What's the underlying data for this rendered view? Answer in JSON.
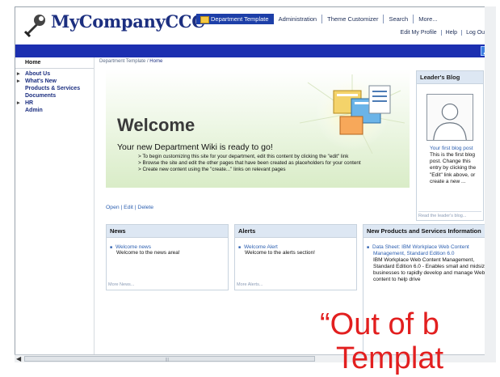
{
  "header": {
    "brand": "MyCompanyCCC",
    "tabs": [
      {
        "label": "Department Template",
        "active": true
      },
      {
        "label": "Administration"
      },
      {
        "label": "Theme Customizer"
      },
      {
        "label": "Search"
      },
      {
        "label": "More..."
      }
    ],
    "subnav": [
      "Edit My Profile",
      "Help",
      "Log Out"
    ]
  },
  "colors": {
    "brand": "#1c2f80",
    "bar": "#1c2fb0",
    "overlay": "#e21f1f"
  },
  "leftnav": [
    {
      "label": "Home",
      "arrow": false,
      "home": true
    },
    {
      "label": "About Us",
      "arrow": true
    },
    {
      "label": "What's New",
      "arrow": true
    },
    {
      "label": "Products & Services",
      "arrow": false
    },
    {
      "label": "Documents",
      "arrow": false
    },
    {
      "label": "HR",
      "arrow": true
    },
    {
      "label": "Admin",
      "arrow": false
    }
  ],
  "breadcrumb": {
    "parent": "Department Template",
    "sep": "/",
    "current": "Home"
  },
  "banner": {
    "welcome": "Welcome",
    "ready": "Your new Department Wiki is ready to go!",
    "bullets": [
      "To begin customizing this site for your department, edit this content by clicking the \"edit\" link",
      "Browse the site and edit the other pages that have been created as placeholders for your content",
      "Create new content using the \"create...\" links on relevant pages"
    ]
  },
  "actions": "Open | Edit | Delete",
  "news": {
    "title": "News",
    "item": "Welcome news",
    "text": "Welcome to the news area!",
    "footer": "More News..."
  },
  "alerts": {
    "title": "Alerts",
    "item": "Welcome Alert",
    "text": "Welcome to the alerts section!",
    "footer": "More Alerts..."
  },
  "products": {
    "title": "New Products and Services Information",
    "item": "Data Sheet: IBM Workplace Web Content Management, Standard Edition 6.0",
    "text": "IBM Workplace Web Content Management, Standard Edition 6.0 - Enables small and midsize businesses to rapidly develop and manage Web content to help drive"
  },
  "blog": {
    "title": "Leader's Blog",
    "post_title": "Your first blog post",
    "post_text": "This is the first blog post. Change this entry by clicking the \"Edit\" link above, or create a new ...",
    "footer": "Read the leader's blog..."
  },
  "overlay": {
    "line1": "“Out of b",
    "line2": "Templat"
  }
}
